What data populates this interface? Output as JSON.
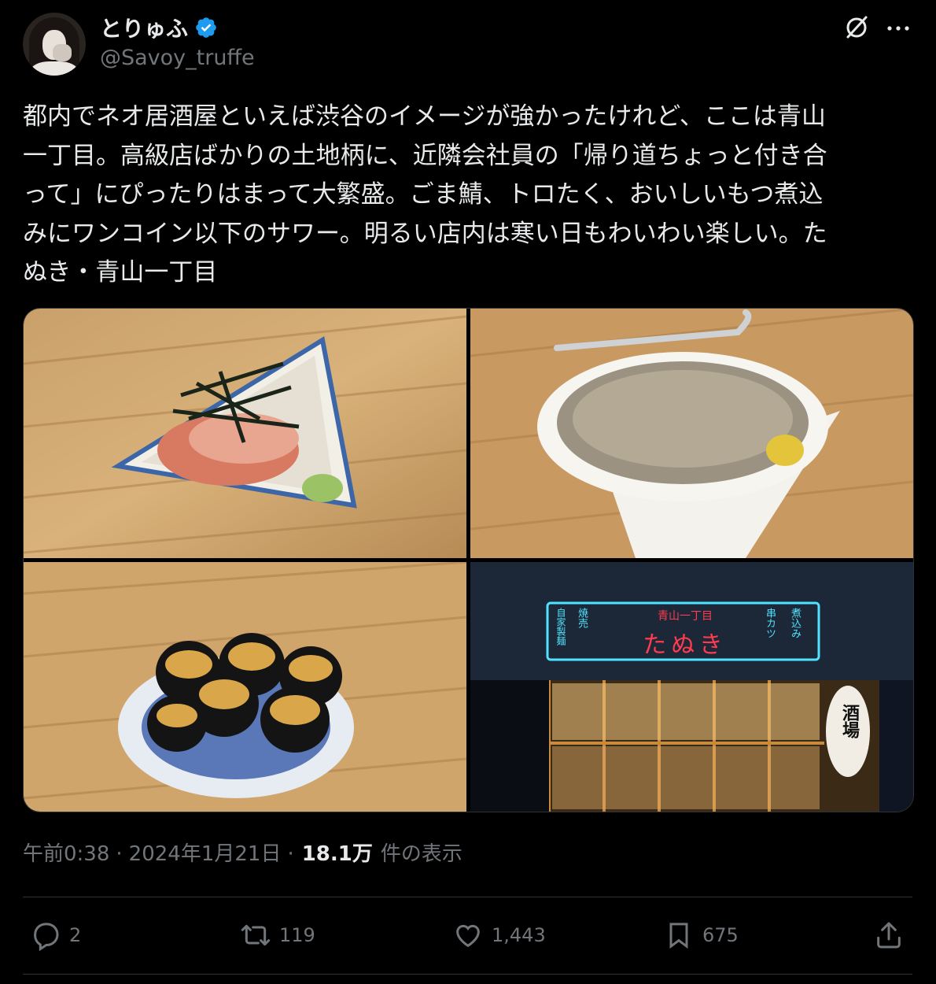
{
  "author": {
    "display_name": "とりゅふ",
    "handle": "@Savoy_truffe",
    "verified_color": "#1d9bf0"
  },
  "tweet": {
    "text": "都内でネオ居酒屋といえば渋谷のイメージが強かったけれど、ここは青山\n一丁目。高級店ばかりの土地柄に、近隣会社員の「帰り道ちょっと付き合\nって」にぴったりはまって大繁盛。ごま鯖、トロたく、おいしいもつ煮込\nみにワンコイン以下のサワー。明るい店内は寒い日もわいわい楽しい。た\nぬき・青山一丁目"
  },
  "media": {
    "sign": {
      "center_small": "青山一丁目",
      "center_big": "たぬき",
      "left_col1": "自家製麺",
      "left_col2": "焼売",
      "right_col1": "串カツ",
      "right_col2": "煮込み",
      "lantern": "酒場",
      "neon_color": "#4fe3ff",
      "neon_red": "#ff3b4f"
    }
  },
  "meta": {
    "time": "午前0:38",
    "date": "2024年1月21日",
    "views": "18.1万",
    "views_label": "件の表示",
    "separator": "·"
  },
  "actions": {
    "reply_count": "2",
    "retweet_count": "119",
    "like_count": "1,443",
    "bookmark_count": "675",
    "icons": [
      "reply-icon",
      "retweet-icon",
      "like-icon",
      "bookmark-icon",
      "share-icon"
    ]
  }
}
